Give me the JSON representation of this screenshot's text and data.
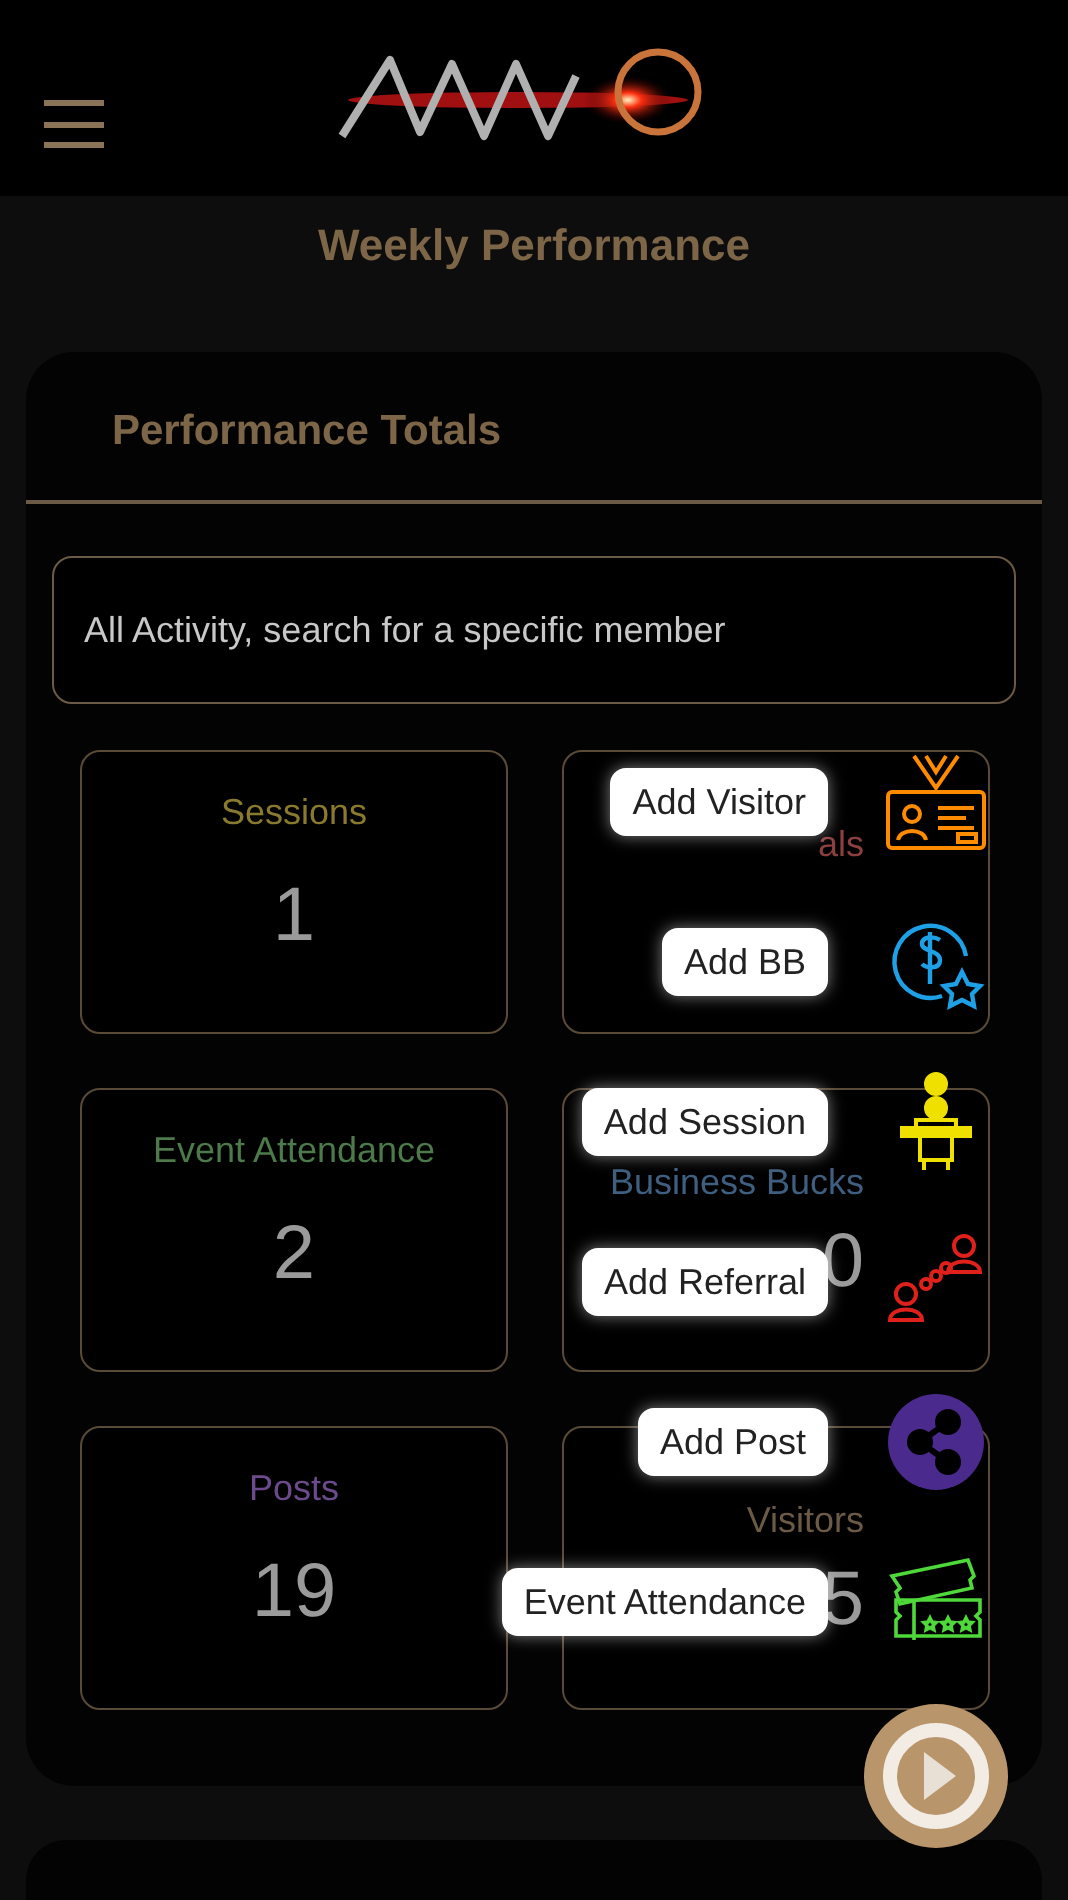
{
  "page_title": "Weekly Performance",
  "panel": {
    "title": "Performance Totals",
    "search": {
      "placeholder": "All Activity, search for a specific member"
    },
    "stats": [
      {
        "title": "Sessions",
        "value": "1",
        "color": "#8a7a2e"
      },
      {
        "title": "als",
        "color": "#8c3f3f"
      },
      {
        "title": "Event Attendance",
        "value": "2",
        "color": "#4c7a4a"
      },
      {
        "title": "Business Bucks",
        "value": "0",
        "color": "#3f5f80"
      },
      {
        "title": "Posts",
        "value": "19",
        "color": "#6b4b8c"
      },
      {
        "title": "Visitors",
        "value": "5",
        "color": "#6b5a45"
      }
    ]
  },
  "speed_dial": [
    {
      "label": "Add Visitor",
      "kind": "visitor"
    },
    {
      "label": "Add BB",
      "kind": "bucks"
    },
    {
      "label": "Add Session",
      "kind": "session"
    },
    {
      "label": "Add Referral",
      "kind": "referral"
    },
    {
      "label": "Add Post",
      "kind": "post"
    },
    {
      "label": "Event Attendance",
      "kind": "event"
    }
  ]
}
